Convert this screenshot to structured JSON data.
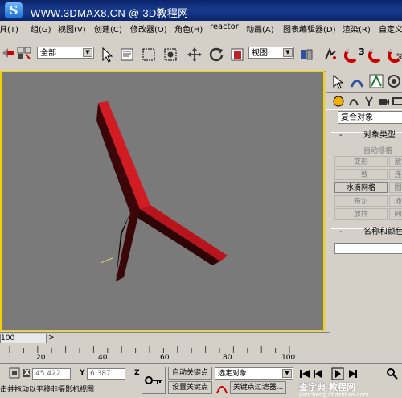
{
  "window": {
    "title": "WWW.3DMAX8.CN @ 3D教程网",
    "logo_letter": "S"
  },
  "menu": [
    "具(T)",
    "组(G)",
    "视图(V)",
    "创建(C)",
    "修改器(O)",
    "角色(H)",
    "reactor",
    "动画(A)",
    "图表编辑器(D)",
    "渲染(R)",
    "自定义"
  ],
  "toolbar": {
    "selection_filter": "全部",
    "ref_coord": "视图",
    "icons": [
      "undo-icon",
      "select-filter-icon",
      "select-object-icon",
      "select-by-name-icon",
      "rect-select-icon",
      "window-crossing-icon",
      "move-icon",
      "rotate-icon",
      "scale-icon",
      "pivot-icon",
      "mirror-icon",
      "snap-icon",
      "angle-snap-icon",
      "percent-snap-icon"
    ],
    "snap_labels": [
      "3",
      "%"
    ]
  },
  "command_panel": {
    "category": "复合对象",
    "rollout_object_type": "对象类型",
    "auto_grid": "自动栅格",
    "buttons": [
      {
        "label": "变形",
        "enabled": false
      },
      {
        "label": "散",
        "enabled": false
      },
      {
        "label": "一致",
        "enabled": false
      },
      {
        "label": "连",
        "enabled": false
      },
      {
        "label": "水滴网格",
        "enabled": true
      },
      {
        "label": "图",
        "enabled": false
      },
      {
        "label": "布尔",
        "enabled": false
      },
      {
        "label": "地",
        "enabled": false
      },
      {
        "label": "放样",
        "enabled": false
      },
      {
        "label": "网",
        "enabled": false
      }
    ],
    "rollout_name_color": "名称和颜色",
    "minus": "-"
  },
  "timeline": {
    "frame_display": "100",
    "ruler_labels": [
      "20",
      "40",
      "60",
      "80",
      "100"
    ]
  },
  "status": {
    "prompt": "击并拖动以平移非摄影机视图",
    "x_label": "X",
    "x_value": "45.422",
    "y_label": "Y",
    "y_value": "6.387",
    "z_label": "Z",
    "auto_key": "自动关键点",
    "set_key": "设置关键点",
    "key_filter_dropdown": "选定对象",
    "key_filters": "关键点过滤器..."
  },
  "watermark": {
    "text": "查字典 教程网",
    "url": "jiaocheng.chazidian.com"
  },
  "colors": {
    "viewport_bg": "#7a7a7a",
    "viewport_border": "#f2d300",
    "object_red": "#d01c22",
    "titlebar": "#0a246a"
  }
}
